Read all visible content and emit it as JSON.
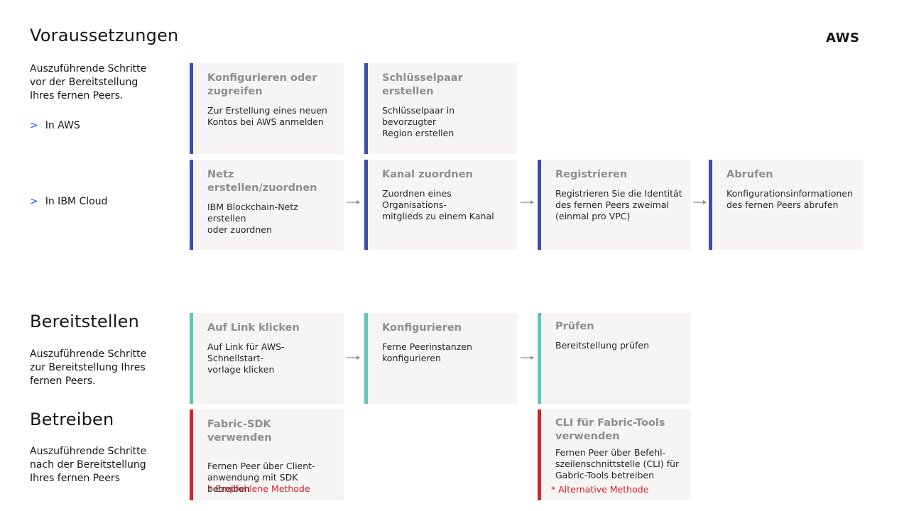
{
  "prereq": {
    "title": "Voraussetzungen",
    "description": "Auszuführende Schritte\nvor der Bereitstellung\nIhres fernen Peers.",
    "aws_link": "In AWS",
    "ibm_link": "In IBM Cloud",
    "platform_label": "AWS",
    "aws_cards": [
      {
        "title": "Konfigurieren oder\nzugreifen",
        "text": "Zur Erstellung eines neuen\nKontos bei AWS anmelden"
      },
      {
        "title": "Schlüsselpaar erstellen",
        "text": "Schlüsselpaar in bevorzugter\nRegion erstellen"
      }
    ],
    "ibm_cards": [
      {
        "title": "Netz erstellen/zuordnen",
        "text": "IBM Blockchain-Netz erstellen\noder zuordnen"
      },
      {
        "title": "Kanal zuordnen",
        "text": "Zuordnen eines Organisations-\nmitglieds zu einem Kanal"
      },
      {
        "title": "Registrieren",
        "text": "Registrieren Sie die Identität\ndes fernen Peers zweimal\n (einmal pro VPC)"
      },
      {
        "title": "Abrufen",
        "text": "Konfigurationsinformationen\ndes fernen Peers abrufen"
      }
    ]
  },
  "deploy": {
    "title": "Bereitstellen",
    "description": "Auszuführende Schritte\nzur Bereitstellung Ihres\nfernen Peers.",
    "cards": [
      {
        "title": "Auf Link klicken",
        "text": "Auf Link für AWS-Schnellstart-\nvorlage klicken"
      },
      {
        "title": "Konfigurieren",
        "text": "Ferne Peerinstanzen\nkonfigurieren"
      },
      {
        "title": "Prüfen",
        "text": "Bereitstellung prüfen"
      }
    ]
  },
  "operate": {
    "title": "Betreiben",
    "description": "Auszuführende Schritte\nnach der Bereitstellung\nIhres fernen Peers",
    "cards": [
      {
        "title": "Fabric-SDK verwenden",
        "text": "Fernen Peer über Client-\nanwendung mit SDK betreiben",
        "note": "* Empfohlene Methode"
      },
      {
        "title": "CLI für Fabric-Tools\nverwenden",
        "text": "Fernen Peer über Befehl-\nszeilenschnittstelle (CLI) für\nGabric-Tools betreiben",
        "note": "* Alternative Methode"
      }
    ]
  },
  "colors": {
    "accent_blue": "#3a4fa6",
    "accent_teal": "#5fc6b9",
    "accent_red": "#d2232a",
    "link_chevron": "#0f62fe",
    "card_bg": "#f7f5f4"
  },
  "icons": {
    "nav": "chevron-right-icon",
    "connector": "arrow-right-icon"
  }
}
